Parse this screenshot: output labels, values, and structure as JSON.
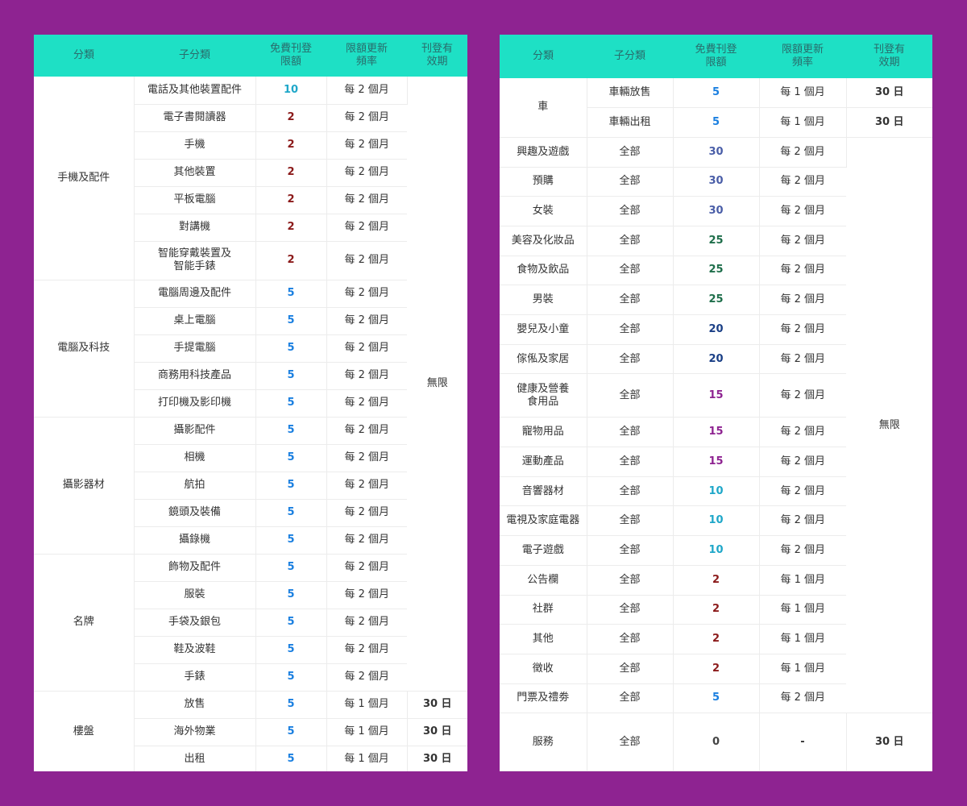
{
  "colors": {
    "background": "#8e2391",
    "header": "#1ee0c5",
    "quota_10": "#1fa7c9",
    "quota_2": "#8b1a1a",
    "quota_5": "#1a7fe0",
    "quota_30": "#4a5ea8",
    "quota_25": "#1e6e4a",
    "quota_20": "#1a3f86",
    "quota_15": "#8e2391",
    "quota_0": "#444444"
  },
  "headers": {
    "category": "分類",
    "subcategory": "子分類",
    "free_quota": "免費刊登\n限額",
    "refresh": "限額更新\n頻率",
    "validity": "刊登有\n效期"
  },
  "left_table": {
    "groups": [
      {
        "category": "手機及配件",
        "items": [
          {
            "sub": "電話及其他裝置配件",
            "quota": "10",
            "freq": "每 2 個月"
          },
          {
            "sub": "電子書閱讀器",
            "quota": "2",
            "freq": "每 2 個月"
          },
          {
            "sub": "手機",
            "quota": "2",
            "freq": "每 2 個月"
          },
          {
            "sub": "其他裝置",
            "quota": "2",
            "freq": "每 2 個月"
          },
          {
            "sub": "平板電腦",
            "quota": "2",
            "freq": "每 2 個月"
          },
          {
            "sub": "對講機",
            "quota": "2",
            "freq": "每 2 個月"
          },
          {
            "sub": "智能穿戴裝置及\n智能手錶",
            "quota": "2",
            "freq": "每 2 個月"
          }
        ]
      },
      {
        "category": "電腦及科技",
        "items": [
          {
            "sub": "電腦周邊及配件",
            "quota": "5",
            "freq": "每 2 個月"
          },
          {
            "sub": "桌上電腦",
            "quota": "5",
            "freq": "每 2 個月"
          },
          {
            "sub": "手提電腦",
            "quota": "5",
            "freq": "每 2 個月"
          },
          {
            "sub": "商務用科技產品",
            "quota": "5",
            "freq": "每 2 個月"
          },
          {
            "sub": "打印機及影印機",
            "quota": "5",
            "freq": "每 2 個月"
          }
        ]
      },
      {
        "category": "攝影器材",
        "items": [
          {
            "sub": "攝影配件",
            "quota": "5",
            "freq": "每 2 個月"
          },
          {
            "sub": "相機",
            "quota": "5",
            "freq": "每 2 個月"
          },
          {
            "sub": "航拍",
            "quota": "5",
            "freq": "每 2 個月"
          },
          {
            "sub": "鏡頭及裝備",
            "quota": "5",
            "freq": "每 2 個月"
          },
          {
            "sub": "攝錄機",
            "quota": "5",
            "freq": "每 2 個月"
          }
        ]
      },
      {
        "category": "名牌",
        "items": [
          {
            "sub": "飾物及配件",
            "quota": "5",
            "freq": "每 2 個月"
          },
          {
            "sub": "服裝",
            "quota": "5",
            "freq": "每 2 個月"
          },
          {
            "sub": "手袋及銀包",
            "quota": "5",
            "freq": "每 2 個月"
          },
          {
            "sub": "鞋及波鞋",
            "quota": "5",
            "freq": "每 2 個月"
          },
          {
            "sub": "手錶",
            "quota": "5",
            "freq": "每 2 個月"
          }
        ]
      },
      {
        "category": "樓盤",
        "items": [
          {
            "sub": "放售",
            "quota": "5",
            "freq": "每 1 個月",
            "validity": "30 日"
          },
          {
            "sub": "海外物業",
            "quota": "5",
            "freq": "每 1 個月",
            "validity": "30 日"
          },
          {
            "sub": "出租",
            "quota": "5",
            "freq": "每 1 個月",
            "validity": "30 日"
          }
        ]
      }
    ],
    "unlimited_label": "無限"
  },
  "right_table": {
    "car_group": {
      "category": "車",
      "items": [
        {
          "sub": "車輛放售",
          "quota": "5",
          "freq": "每 1 個月",
          "validity": "30 日"
        },
        {
          "sub": "車輛出租",
          "quota": "5",
          "freq": "每 1 個月",
          "validity": "30 日"
        }
      ]
    },
    "rows": [
      {
        "category": "興趣及遊戲",
        "sub": "全部",
        "quota": "30",
        "freq": "每 2 個月"
      },
      {
        "category": "預購",
        "sub": "全部",
        "quota": "30",
        "freq": "每 2 個月"
      },
      {
        "category": "女裝",
        "sub": "全部",
        "quota": "30",
        "freq": "每 2 個月"
      },
      {
        "category": "美容及化妝品",
        "sub": "全部",
        "quota": "25",
        "freq": "每 2 個月"
      },
      {
        "category": "食物及飲品",
        "sub": "全部",
        "quota": "25",
        "freq": "每 2 個月"
      },
      {
        "category": "男裝",
        "sub": "全部",
        "quota": "25",
        "freq": "每 2 個月"
      },
      {
        "category": "嬰兒及小童",
        "sub": "全部",
        "quota": "20",
        "freq": "每 2 個月"
      },
      {
        "category": "傢俬及家居",
        "sub": "全部",
        "quota": "20",
        "freq": "每 2 個月"
      },
      {
        "category": "健康及營養\n食用品",
        "sub": "全部",
        "quota": "15",
        "freq": "每 2 個月"
      },
      {
        "category": "寵物用品",
        "sub": "全部",
        "quota": "15",
        "freq": "每 2 個月"
      },
      {
        "category": "運動產品",
        "sub": "全部",
        "quota": "15",
        "freq": "每 2 個月"
      },
      {
        "category": "音響器材",
        "sub": "全部",
        "quota": "10",
        "freq": "每 2 個月"
      },
      {
        "category": "電視及家庭電器",
        "sub": "全部",
        "quota": "10",
        "freq": "每 2 個月"
      },
      {
        "category": "電子遊戲",
        "sub": "全部",
        "quota": "10",
        "freq": "每 2 個月"
      },
      {
        "category": "公告欄",
        "sub": "全部",
        "quota": "2",
        "freq": "每 1 個月"
      },
      {
        "category": "社群",
        "sub": "全部",
        "quota": "2",
        "freq": "每 1 個月"
      },
      {
        "category": "其他",
        "sub": "全部",
        "quota": "2",
        "freq": "每 1 個月"
      },
      {
        "category": "徵收",
        "sub": "全部",
        "quota": "2",
        "freq": "每 1 個月"
      },
      {
        "category": "門票及禮劵",
        "sub": "全部",
        "quota": "5",
        "freq": "每 2 個月"
      }
    ],
    "unlimited_label": "無限",
    "service_row": {
      "category": "服務",
      "sub": "全部",
      "quota": "0",
      "freq": "-",
      "validity": "30 日"
    }
  }
}
